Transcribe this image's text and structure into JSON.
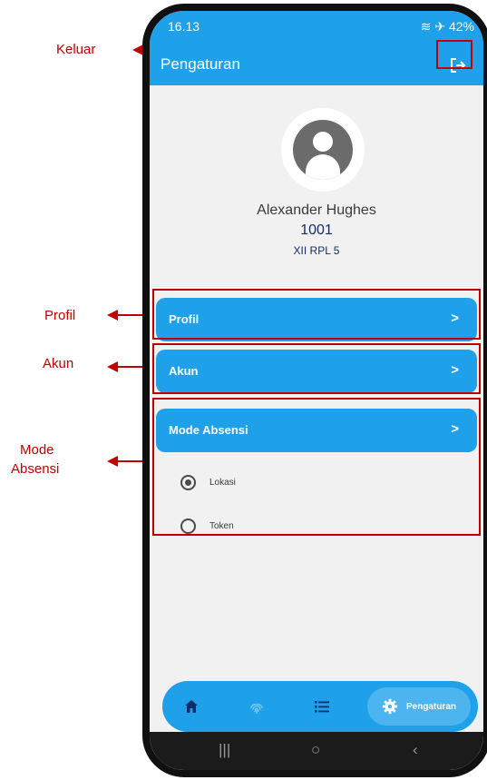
{
  "annotations": {
    "keluar": "Keluar",
    "profil": "Profil",
    "akun": "Akun",
    "mode_absensi_line1": "Mode",
    "mode_absensi_line2": "Absensi"
  },
  "status_bar": {
    "time": "16.13",
    "battery": "42%"
  },
  "app_bar": {
    "title": "Pengaturan",
    "logout_icon": "logout-icon"
  },
  "profile": {
    "avatar_icon": "person-icon",
    "name": "Alexander Hughes",
    "id": "1001",
    "class": "XII RPL 5"
  },
  "menu": {
    "profil": "Profil",
    "akun": "Akun",
    "mode_absensi": "Mode Absensi",
    "chevron": ">"
  },
  "mode_options": [
    {
      "label": "Lokasi",
      "selected": true
    },
    {
      "label": "Token",
      "selected": false
    }
  ],
  "bottom_nav": {
    "items": [
      "home-icon",
      "fingerprint-icon",
      "list-icon",
      "settings-icon"
    ],
    "active_label": "Pengaturan"
  },
  "system_nav": {
    "recents": "|||",
    "home": "○",
    "back": "‹"
  },
  "colors": {
    "primary": "#1ea0ea",
    "annotation": "#c00000",
    "background": "#f1f1f1"
  }
}
